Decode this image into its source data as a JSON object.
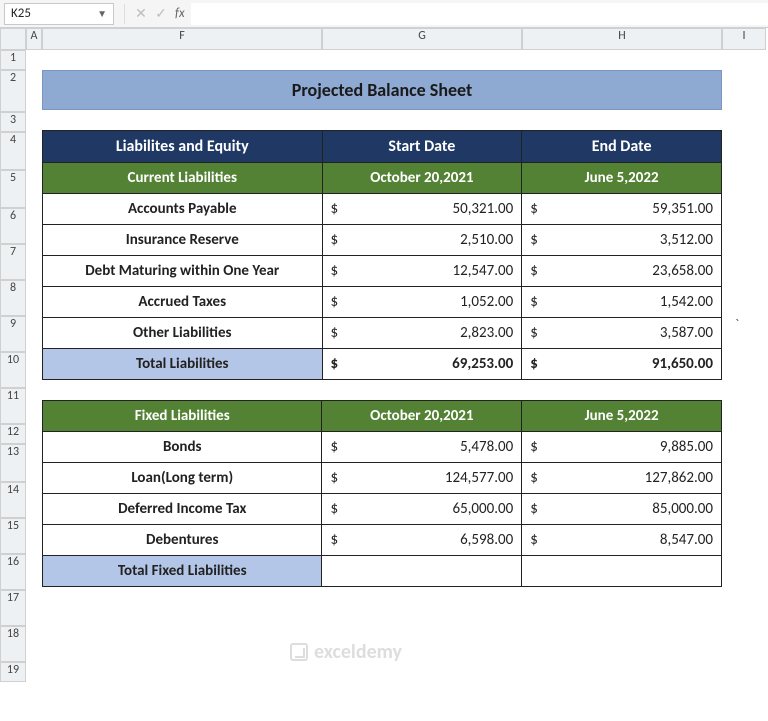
{
  "ribbon": {
    "name_box": "K25",
    "fx_label": "fx",
    "formula_value": ""
  },
  "columns": [
    "A",
    "F",
    "G",
    "H",
    "I"
  ],
  "rows": [
    "1",
    "2",
    "3",
    "4",
    "5",
    "6",
    "7",
    "8",
    "9",
    "10",
    "11",
    "12",
    "13",
    "14",
    "15",
    "16",
    "17",
    "18",
    "19"
  ],
  "title": "Projected Balance Sheet",
  "table1": {
    "headers": {
      "c1": "Liabilites and Equity",
      "c2": "Start Date",
      "c3": "End Date"
    },
    "subheaders": {
      "c1": "Current Liabilities",
      "c2": "October 20,2021",
      "c3": "June 5,2022"
    },
    "rows": [
      {
        "label": "Accounts Payable",
        "start": "50,321.00",
        "end": "59,351.00"
      },
      {
        "label": "Insurance Reserve",
        "start": "2,510.00",
        "end": "3,512.00"
      },
      {
        "label": "Debt Maturing within One Year",
        "start": "12,547.00",
        "end": "23,658.00"
      },
      {
        "label": "Accrued Taxes",
        "start": "1,052.00",
        "end": "1,542.00"
      },
      {
        "label": "Other Liabilities",
        "start": "2,823.00",
        "end": "3,587.00"
      }
    ],
    "total": {
      "label": "Total Liabilities",
      "start": "69,253.00",
      "end": "91,650.00"
    }
  },
  "table2": {
    "subheaders": {
      "c1": "Fixed Liabilities",
      "c2": "October 20,2021",
      "c3": "June 5,2022"
    },
    "rows": [
      {
        "label": "Bonds",
        "start": "5,478.00",
        "end": "9,885.00"
      },
      {
        "label": "Loan(Long term)",
        "start": "124,577.00",
        "end": "127,862.00"
      },
      {
        "label": "Deferred Income Tax",
        "start": "65,000.00",
        "end": "85,000.00"
      },
      {
        "label": "Debentures",
        "start": "6,598.00",
        "end": "8,547.00"
      }
    ],
    "total": {
      "label": "Total Fixed Liabilities",
      "start": "",
      "end": ""
    }
  },
  "currency": "$",
  "watermark": "exceldemy",
  "stray": "`",
  "chart_data": {
    "type": "table",
    "title": "Projected Balance Sheet",
    "sections": [
      {
        "name": "Current Liabilities",
        "columns": [
          "October 20,2021",
          "June 5,2022"
        ],
        "rows": [
          [
            "Accounts Payable",
            50321.0,
            59351.0
          ],
          [
            "Insurance Reserve",
            2510.0,
            3512.0
          ],
          [
            "Debt Maturing within One Year",
            12547.0,
            23658.0
          ],
          [
            "Accrued Taxes",
            1052.0,
            1542.0
          ],
          [
            "Other Liabilities",
            2823.0,
            3587.0
          ]
        ],
        "total": [
          "Total Liabilities",
          69253.0,
          91650.0
        ]
      },
      {
        "name": "Fixed Liabilities",
        "columns": [
          "October 20,2021",
          "June 5,2022"
        ],
        "rows": [
          [
            "Bonds",
            5478.0,
            9885.0
          ],
          [
            "Loan(Long term)",
            124577.0,
            127862.0
          ],
          [
            "Deferred Income Tax",
            65000.0,
            85000.0
          ],
          [
            "Debentures",
            6598.0,
            8547.0
          ]
        ],
        "total": [
          "Total Fixed Liabilities",
          null,
          null
        ]
      }
    ]
  }
}
